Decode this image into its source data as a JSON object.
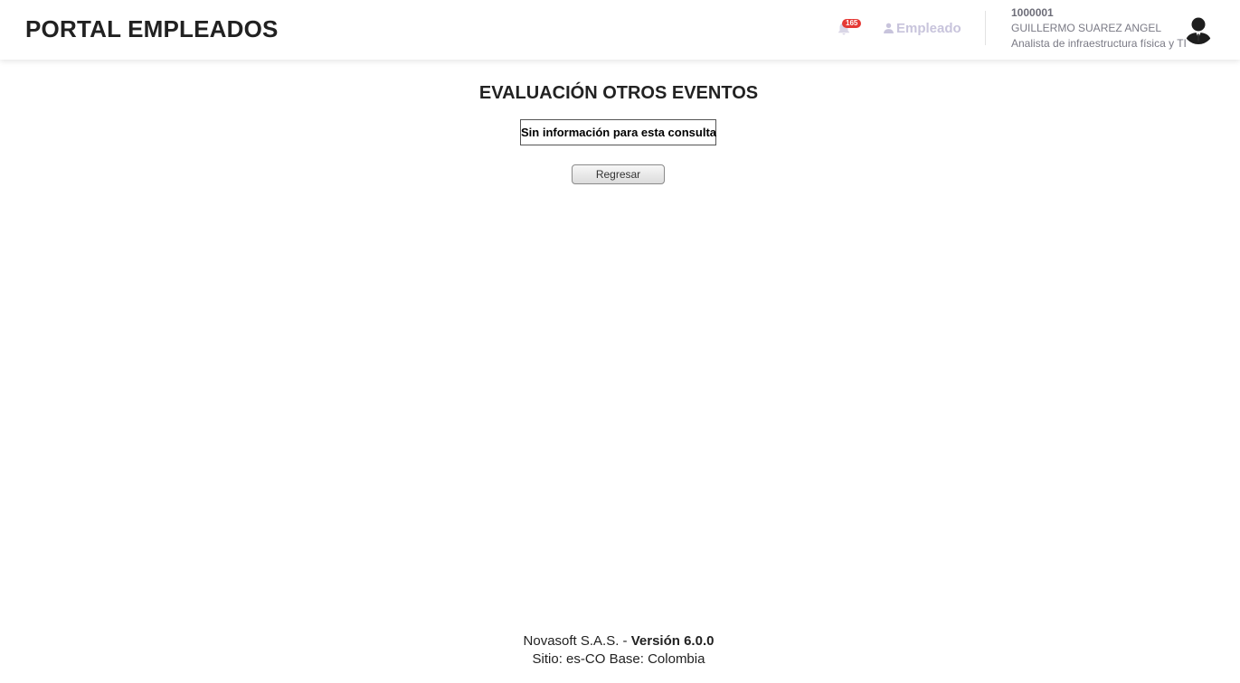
{
  "header": {
    "brand": "PORTAL EMPLEADOS",
    "notifications_count": "165",
    "role_label": "Empleado",
    "user": {
      "id": "1000001",
      "name": "GUILLERMO SUAREZ ANGEL",
      "position": "Analista de infraestructura física y TI"
    },
    "icons": {
      "bell": "bell-icon",
      "role": "user-icon",
      "avatar": "avatar-silhouette"
    },
    "colors": {
      "badge": "#e53935",
      "role": "#c8c4dc"
    }
  },
  "main": {
    "title": "EVALUACIÓN OTROS EVENTOS",
    "message": "Sin información para esta consulta",
    "back_button": "Regresar"
  },
  "footer": {
    "company": "Novasoft S.A.S. -",
    "version": "Versión 6.0.0",
    "site": "Sitio: es-CO Base: Colombia"
  }
}
